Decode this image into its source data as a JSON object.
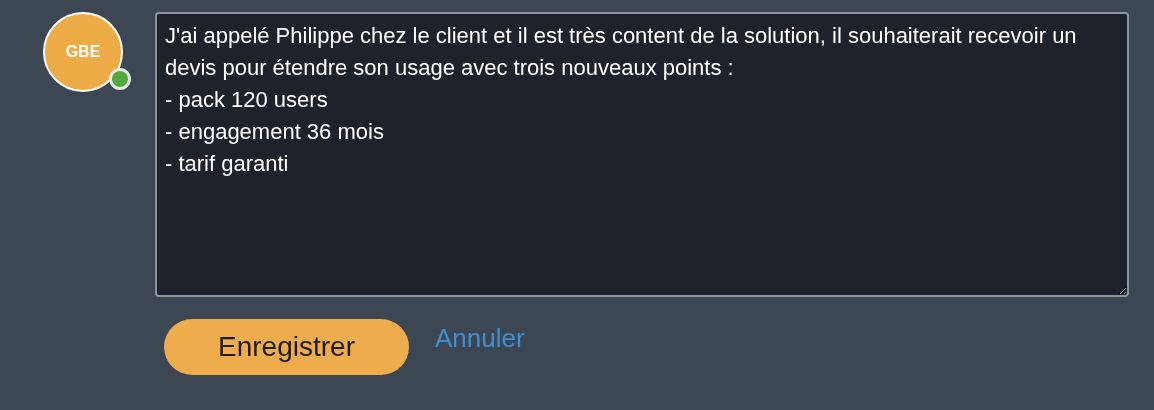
{
  "avatar": {
    "initials": "GBE",
    "online": true
  },
  "comment": {
    "value": "J'ai appelé Philippe chez le client et il est très content de la solution, il souhaiterait recevoir un devis pour étendre son usage avec trois nouveaux points :\n- pack 120 users\n- engagement 36 mois\n- tarif garanti"
  },
  "buttons": {
    "save": "Enregistrer",
    "cancel": "Annuler"
  }
}
